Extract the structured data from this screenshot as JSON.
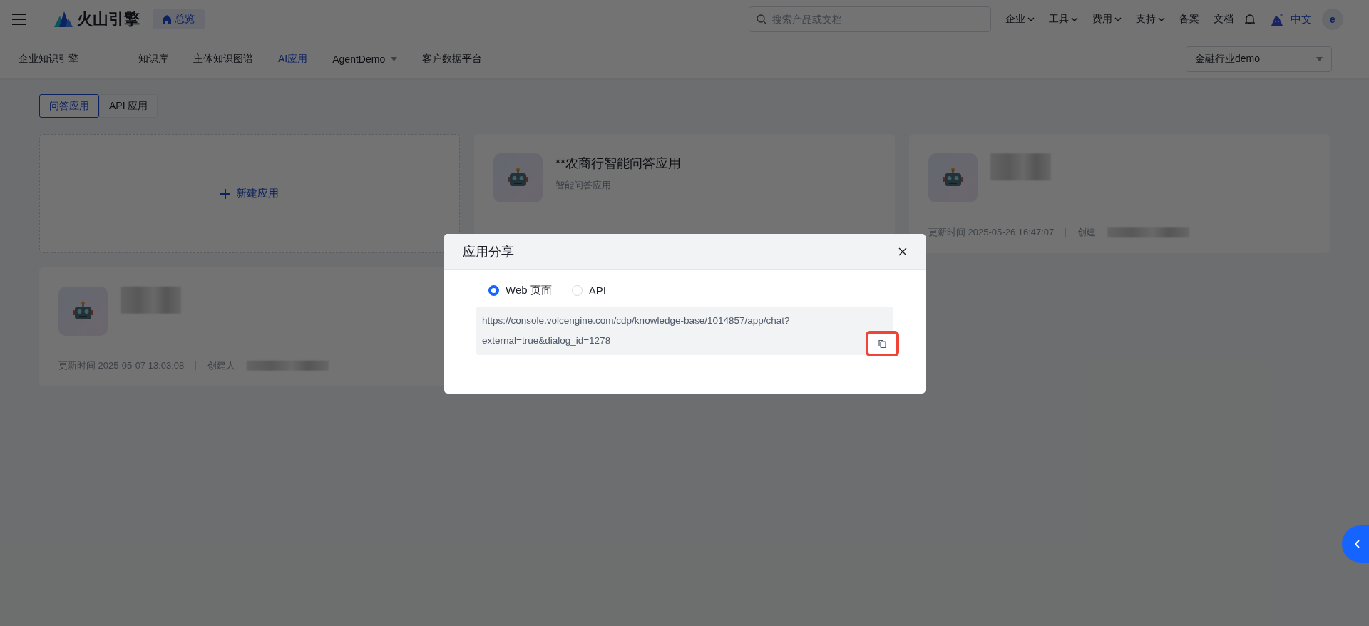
{
  "topbar": {
    "brand": "火山引擎",
    "home": "总览",
    "search": {
      "placeholder": "搜索产品或文档"
    },
    "menus": [
      {
        "label": "企业",
        "dropdown": true
      },
      {
        "label": "工具",
        "dropdown": true
      },
      {
        "label": "费用",
        "dropdown": true
      },
      {
        "label": "支持",
        "dropdown": true
      },
      {
        "label": "备案",
        "dropdown": false
      },
      {
        "label": "文档",
        "dropdown": false
      }
    ],
    "language": "中文",
    "avatar": "e"
  },
  "subnav": {
    "product": "企业知识引擎",
    "items": [
      {
        "label": "知识库",
        "selected": false,
        "dropdown": false
      },
      {
        "label": "主体知识图谱",
        "selected": false,
        "dropdown": false
      },
      {
        "label": "AI应用",
        "selected": true,
        "dropdown": false
      },
      {
        "label": "AgentDemo",
        "selected": false,
        "dropdown": true
      },
      {
        "label": "客户数据平台",
        "selected": false,
        "dropdown": false
      }
    ],
    "workspace": "金融行业demo"
  },
  "app_tabs": [
    {
      "label": "问答应用",
      "selected": true
    },
    {
      "label": "API 应用",
      "selected": false
    }
  ],
  "new_app": "新建应用",
  "apps": [
    {
      "title": "**农商行智能问答应用",
      "subtitle": "智能问答应用",
      "redacted": false
    },
    {
      "updated": "更新时间 2025-05-26 16:47:07",
      "creator": "创建",
      "redacted": true
    },
    {
      "updated": "更新时间 2025-05-07 13:03:08",
      "creator": "创建人",
      "redacted": true
    }
  ],
  "dialog": {
    "title": "应用分享",
    "options": [
      {
        "label": "Web 页面",
        "selected": true
      },
      {
        "label": "API",
        "selected": false
      }
    ],
    "url_lines": [
      "https://console.volcengine.com/cdp/knowledge-base/1014857/app/chat?",
      "external=true&dialog_id=1278"
    ],
    "copy_highlighted": true
  }
}
